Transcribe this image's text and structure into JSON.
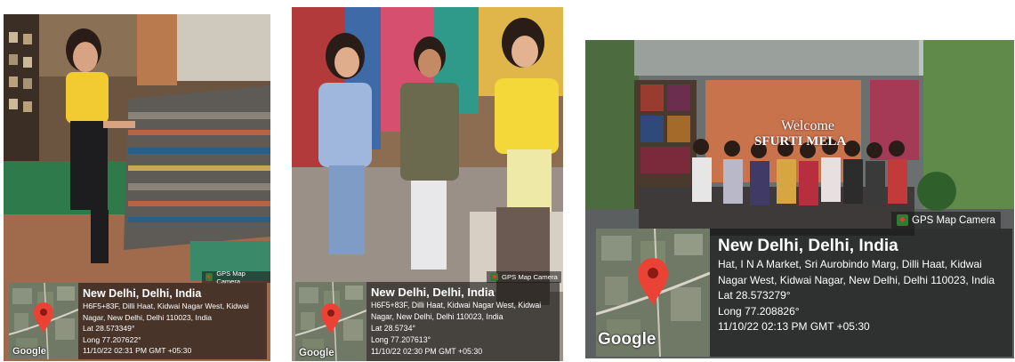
{
  "photos": [
    {
      "badge": "GPS Map Camera",
      "map_watermark": "Google",
      "location": "New Delhi, Delhi, India",
      "address": "H6F5+83F, Dilli Haat, Kidwai Nagar West, Kidwai Nagar, New Delhi, Delhi 110023, India",
      "lat": "Lat 28.573349°",
      "long": "Long 77.207622°",
      "datetime": "11/10/22 02:31 PM GMT +05:30"
    },
    {
      "badge": "GPS Map Camera",
      "map_watermark": "Google",
      "location": "New Delhi, Delhi, India",
      "address": "H6F5+83F, Dilli Haat, Kidwai Nagar West, Kidwai Nagar, New Delhi, Delhi 110023, India",
      "lat": "Lat 28.5734°",
      "long": "Long 77.207613°",
      "datetime": "11/10/22 02:30 PM GMT +05:30"
    },
    {
      "badge": "GPS Map Camera",
      "map_watermark": "Google",
      "location": "New Delhi, Delhi, India",
      "address": "Hat, I N A Market, Sri Aurobindo Marg, Dilli Haat, Kidwai Nagar West, Kidwai Nagar, New Delhi, Delhi 110023, India",
      "lat": "Lat 28.573279°",
      "long": "Long 77.208826°",
      "datetime": "11/10/22 02:13 PM GMT +05:30",
      "banner": {
        "line1": "Welcome",
        "line2": "SFURTI MELA"
      }
    }
  ],
  "colors": {
    "overlay": "#141414",
    "map_pin": "#ea4335",
    "badge_icon": "#2e7d32"
  }
}
